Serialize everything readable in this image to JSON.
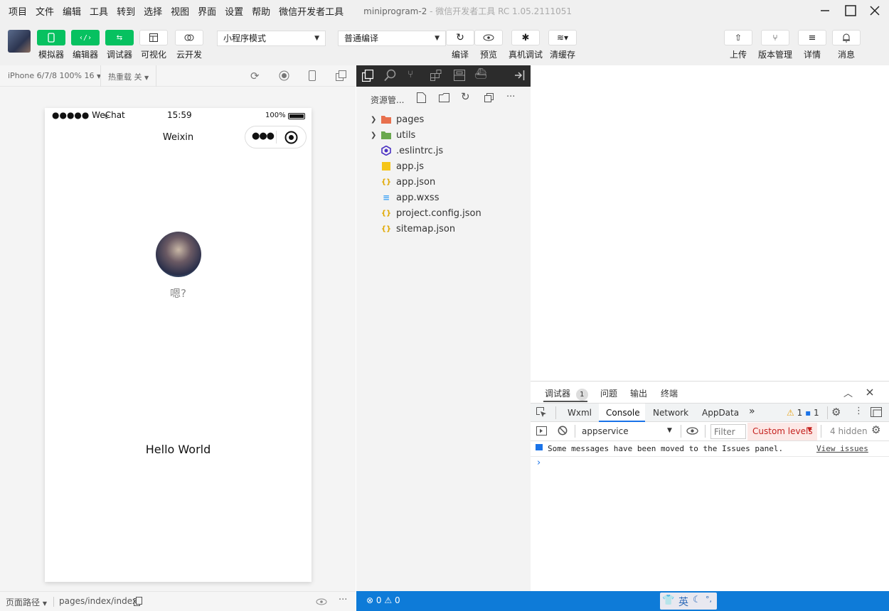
{
  "menu": [
    "项目",
    "文件",
    "编辑",
    "工具",
    "转到",
    "选择",
    "视图",
    "界面",
    "设置",
    "帮助",
    "微信开发者工具"
  ],
  "window_title": "miniprogram-2",
  "window_subtitle": "- 微信开发者工具 RC 1.05.2111051",
  "toolbar": {
    "simulator": "模拟器",
    "editor": "编辑器",
    "debugger": "调试器",
    "visual": "可视化",
    "cloud": "云开发",
    "mode_select": "小程序模式",
    "compile_select": "普通编译",
    "compile": "编译",
    "preview": "预览",
    "real_debug": "真机调试",
    "clear_cache": "清缓存",
    "upload": "上传",
    "version": "版本管理",
    "details": "详情",
    "messages": "消息"
  },
  "simulator": {
    "device": "iPhone 6/7/8 100% 16",
    "hot_reload": "热重载 关",
    "status_carrier": "●●●●● WeChat",
    "status_time": "15:59",
    "status_battery": "100%",
    "nav_title": "Weixin",
    "nickname": "嗯?",
    "hello": "Hello World",
    "page_path_label": "页面路径",
    "page_path": "pages/index/index"
  },
  "explorer": {
    "title": "资源管...",
    "files": [
      {
        "name": "pages",
        "type": "folder",
        "icon_color": "#e8704d"
      },
      {
        "name": "utils",
        "type": "folder",
        "icon_color": "#6aa84f"
      },
      {
        "name": ".eslintrc.js",
        "type": "eslint",
        "icon_color": "#4b32c3"
      },
      {
        "name": "app.js",
        "type": "js",
        "icon_color": "#f5c518"
      },
      {
        "name": "app.json",
        "type": "json",
        "icon_color": "#f5c518"
      },
      {
        "name": "app.wxss",
        "type": "css",
        "icon_color": "#42a5f5"
      },
      {
        "name": "project.config.json",
        "type": "json",
        "icon_color": "#f5c518"
      },
      {
        "name": "sitemap.json",
        "type": "json",
        "icon_color": "#f5c518"
      }
    ]
  },
  "status": {
    "errors": "0",
    "warnings": "0",
    "ime": "英"
  },
  "devtools": {
    "tabs": [
      {
        "label": "调试器",
        "badge": "1"
      },
      {
        "label": "问题"
      },
      {
        "label": "输出"
      },
      {
        "label": "终端"
      }
    ],
    "panels": [
      "Wxml",
      "Console",
      "Network",
      "AppData"
    ],
    "active_panel": "Console",
    "warn_count": "1",
    "info_count": "1",
    "context": "appservice",
    "filter_placeholder": "Filter",
    "levels": "Custom levels",
    "hidden": "4 hidden",
    "message": "Some messages have been moved to the Issues panel.",
    "view_issues": "View issues"
  },
  "colors": {
    "green": "#07c160",
    "status_blue": "#0e7bd8",
    "dark_bar": "#2c2c2c"
  }
}
